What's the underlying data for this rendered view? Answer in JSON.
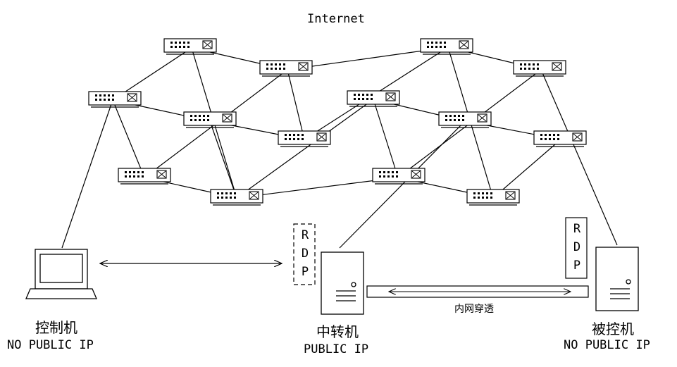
{
  "title": "Internet",
  "nodes": {
    "controller": {
      "name": "控制机",
      "status": "NO PUBLIC IP",
      "icon": "laptop-icon"
    },
    "relay": {
      "name": "中转机",
      "status": "PUBLIC IP",
      "icon": "server-icon"
    },
    "target": {
      "name": "被控机",
      "status": "NO PUBLIC IP",
      "icon": "server-icon"
    }
  },
  "rdp_relay": "R D P",
  "rdp_target": "R D P",
  "tunnel_label": "内网穿透",
  "switch_icon": "network-switch-icon",
  "colors": {
    "line": "#000000",
    "background": "#ffffff"
  }
}
